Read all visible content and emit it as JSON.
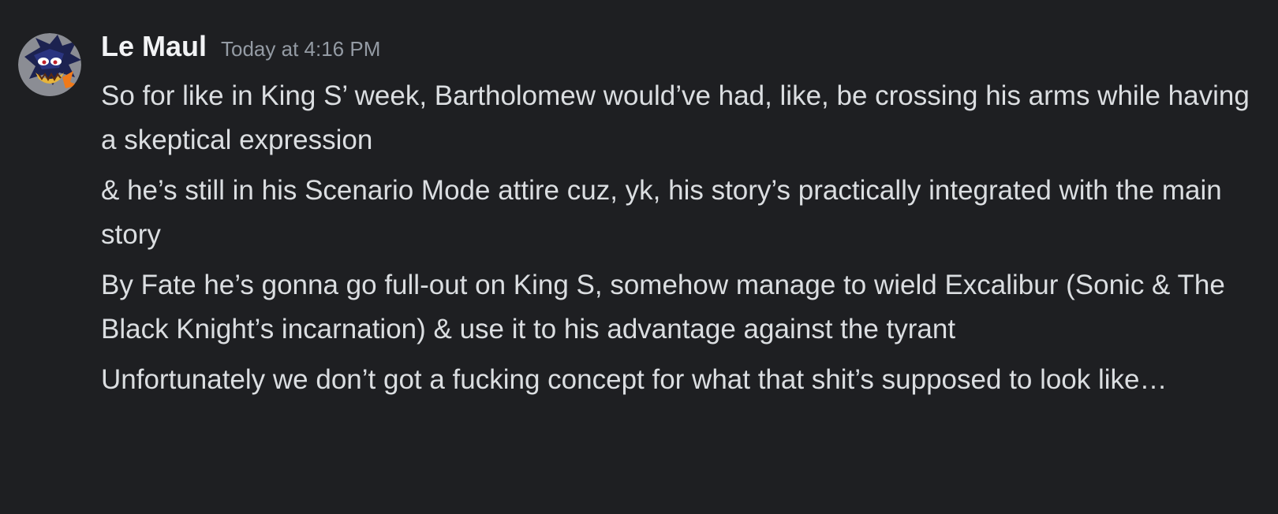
{
  "message": {
    "author": "Le Maul",
    "timestamp": "Today at 4:16 PM",
    "avatar_icon": "dark-hedgehog-avatar",
    "lines": [
      "So for like in King S’ week, Bartholomew would’ve had, like, be crossing his arms while having a skeptical expression",
      "& he’s still in his Scenario Mode attire cuz, yk, his story’s practically integrated with the main story",
      "By Fate he’s gonna go full-out on King S, somehow manage to wield Excalibur (Sonic & The Black Knight’s incarnation) & use it to his advantage against the tyrant",
      "Unfortunately we don’t got a fucking concept for what that shit’s supposed to look like…"
    ]
  },
  "colors": {
    "background": "#1e1f22",
    "username": "#f2f3f5",
    "timestamp": "#949ba4",
    "text": "#dbdee1"
  }
}
